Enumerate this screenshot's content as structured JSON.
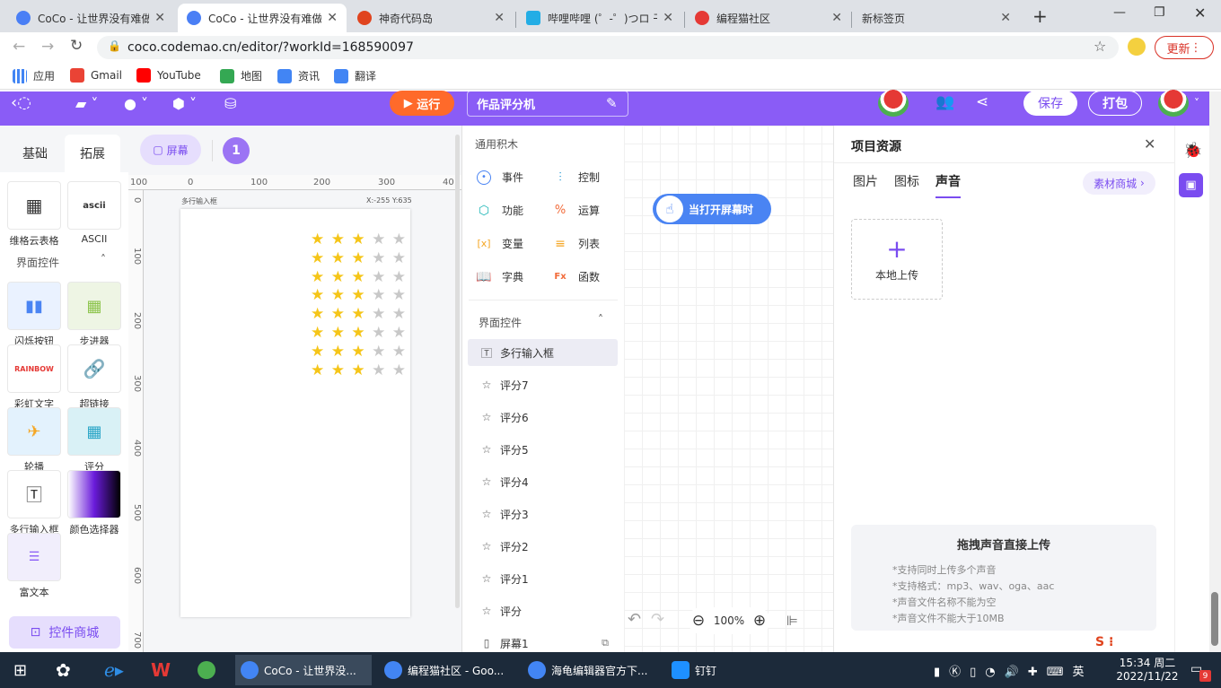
{
  "browser": {
    "tabs": [
      {
        "title": "CoCo - 让世界没有难做",
        "color": "#4a7ff5"
      },
      {
        "title": "CoCo - 让世界没有难做",
        "color": "#4a7ff5"
      },
      {
        "title": "神奇代码岛",
        "color": "#e0441e"
      },
      {
        "title": "哔哩哔哩 (゜-゜)つロ 干",
        "color": "#23ade5"
      },
      {
        "title": "编程猫社区",
        "color": "#e53935"
      },
      {
        "title": "新标签页",
        "color": "#dee1e6"
      }
    ],
    "url": "coco.codemao.cn/editor/?workId=168590097",
    "update_label": "更新",
    "bookmarks": [
      {
        "label": "应用",
        "color": "#4285f4"
      },
      {
        "label": "Gmail",
        "color": "#ea4335"
      },
      {
        "label": "YouTube",
        "color": "#ff0000"
      },
      {
        "label": "地图",
        "color": "#34a853"
      },
      {
        "label": "资讯",
        "color": "#4285f4"
      },
      {
        "label": "翻译",
        "color": "#4285f4"
      }
    ]
  },
  "toolbar": {
    "run_label": "运行",
    "work_name": "作品评分机",
    "save_label": "保存",
    "pack_label": "打包"
  },
  "left": {
    "tabs": [
      "基础",
      "拓展"
    ],
    "top_items": [
      {
        "label": "维格云表格"
      },
      {
        "label": "ASCII"
      }
    ],
    "section_title": "界面控件",
    "items": [
      {
        "label": "闪烁按钮"
      },
      {
        "label": "步进器"
      },
      {
        "label": "彩虹文字"
      },
      {
        "label": "超链接"
      },
      {
        "label": "轮播"
      },
      {
        "label": "评分"
      },
      {
        "label": "多行输入框"
      },
      {
        "label": "颜色选择器"
      },
      {
        "label": "富文本"
      }
    ],
    "shop_label": "控件商城"
  },
  "stage": {
    "screen_label": "屏幕",
    "page_number": "1",
    "ruler_h": [
      "100",
      "0",
      "100",
      "200",
      "300",
      "40"
    ],
    "ruler_v": [
      "0",
      "100",
      "200",
      "300",
      "400",
      "500",
      "600",
      "700"
    ],
    "component_label": "多行输入框",
    "coords": "X:-255 Y:635",
    "rating_rows": [
      3,
      3,
      3,
      3,
      3,
      3,
      3,
      3
    ],
    "stars_per_row": 5
  },
  "blocks": {
    "header": "通用积木",
    "categories": [
      {
        "label": "事件",
        "color": "#4a84f3",
        "icon": "◉"
      },
      {
        "label": "控制",
        "color": "#2a9ad6",
        "icon": "⫶"
      },
      {
        "label": "功能",
        "color": "#1ab5b5",
        "icon": "⬡"
      },
      {
        "label": "运算",
        "color": "#f26b3a",
        "icon": "%"
      },
      {
        "label": "变量",
        "color": "#f5a623",
        "icon": "x"
      },
      {
        "label": "列表",
        "color": "#f5a623",
        "icon": "≡"
      },
      {
        "label": "字典",
        "color": "#7a8af3",
        "icon": "▯"
      },
      {
        "label": "函数",
        "color": "#f26b3a",
        "icon": "Fx"
      }
    ],
    "section_title": "界面控件",
    "widgets": [
      "多行输入框",
      "评分7",
      "评分6",
      "评分5",
      "评分4",
      "评分3",
      "评分2",
      "评分1",
      "评分",
      "屏幕1"
    ]
  },
  "workspace": {
    "event_label": "当打开屏幕时",
    "zoom": "100%"
  },
  "resources": {
    "title": "项目资源",
    "tabs": [
      "图片",
      "图标",
      "声音"
    ],
    "shop_label": "素材商城",
    "upload_label": "本地上传",
    "drop_title": "拖拽声音直接上传",
    "drop_notes": [
      "*支持同时上传多个声音",
      "*支持格式：mp3、wav、oga、aac",
      "*声音文件名称不能为空",
      "*声音文件不能大于10MB"
    ]
  },
  "taskbar": {
    "items": [
      {
        "label": "CoCo - 让世界没..."
      },
      {
        "label": "编程猫社区 - Goo..."
      },
      {
        "label": "海龟编辑器官方下..."
      },
      {
        "label": "钉钉"
      }
    ],
    "time": "15:34 周二",
    "date": "2022/11/22",
    "badge": "9"
  }
}
